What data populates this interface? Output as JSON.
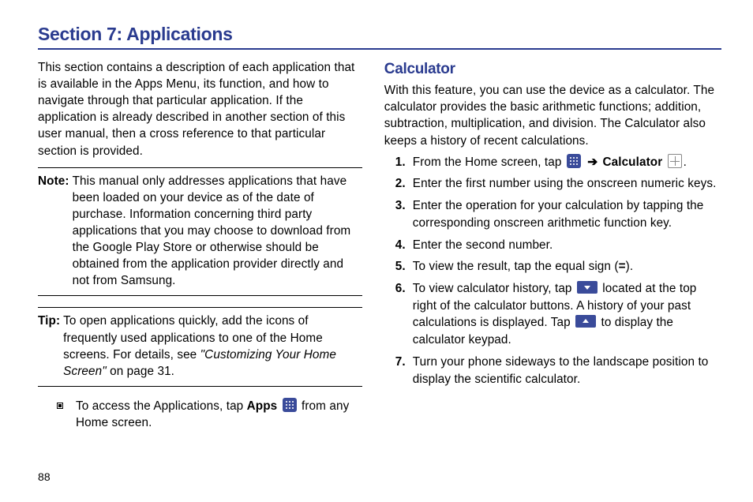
{
  "page_number": "88",
  "title": "Section 7: Applications",
  "left": {
    "intro": "This section contains a description of each application that is available in the Apps Menu, its function, and how to navigate through that particular application. If the application is already described in another section of this user manual, then a cross reference to that particular section is provided.",
    "note_label": "Note:",
    "note_body": "This manual only addresses applications that have been loaded on your device as of the date of purchase. Information concerning third party applications that you may choose to download from the Google Play Store or otherwise should be obtained from the application provider directly and not from Samsung.",
    "tip_label": "Tip:",
    "tip_a": "To open applications quickly, add the icons of frequently used applications to one of the Home screens. For details, see ",
    "tip_xref": "\"Customizing Your Home Screen\"",
    "tip_b": " on page 31.",
    "access_a": "To access the Applications, tap ",
    "access_bold": "Apps",
    "access_b": " from any Home screen."
  },
  "arrow": "➔",
  "right": {
    "heading": "Calculator",
    "intro": "With this feature, you can use the device as a calculator. The calculator provides the basic arithmetic functions; addition, subtraction, multiplication, and division. The Calculator also keeps a history of recent calculations.",
    "s1_a": "From the Home screen, tap ",
    "s1_bold": "Calculator",
    "s1_period": ".",
    "s2": "Enter the first number using the onscreen numeric keys.",
    "s3": "Enter the operation for your calculation by tapping the corresponding onscreen arithmetic function key.",
    "s4": "Enter the second number.",
    "s5_a": "To view the result, tap the equal sign (",
    "s5_b": "=",
    "s5_c": ").",
    "s6_a": "To view calculator history, tap ",
    "s6_b": " located at the top right of the calculator buttons. A history of your past calculations is displayed. Tap ",
    "s6_c": " to display the calculator keypad.",
    "s7": "Turn your phone sideways to the landscape position to display the scientific calculator."
  }
}
